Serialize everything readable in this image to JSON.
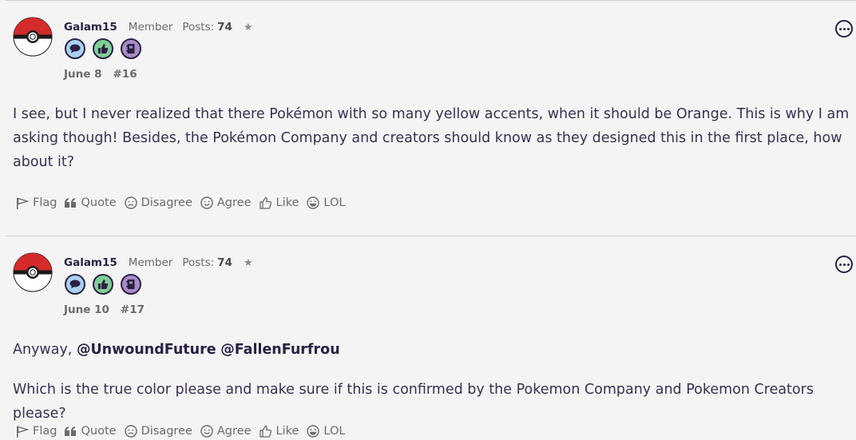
{
  "posts": [
    {
      "username": "Galam15",
      "role": "Member",
      "posts_label": "Posts:",
      "posts_count": "74",
      "date": "June 8",
      "post_number": "#16",
      "body": [
        "I see, but I never realized that there Pokémon with so many yellow accents, when it should be Orange. This is why I am asking though! Besides, the Pokémon Company and creators should know as they designed this in the first place, how about it?"
      ]
    },
    {
      "username": "Galam15",
      "role": "Member",
      "posts_label": "Posts:",
      "posts_count": "74",
      "date": "June 10",
      "post_number": "#17",
      "greeting": "Anyway,",
      "mention_1": "@UnwoundFuture",
      "mention_2": "@FallenFurfrou",
      "question": "Which is the true color please and make sure if this is confirmed by the Pokemon Company and Pokemon Creators please?"
    }
  ],
  "actions": {
    "flag": "Flag",
    "quote": "Quote",
    "disagree": "Disagree",
    "agree": "Agree",
    "like": "Like",
    "lol": "LOL"
  },
  "colors": {
    "page_bg": "#f4f4f4",
    "text": "#3a3150",
    "username": "#2b2143",
    "muted": "#6b6b6b",
    "pokeball_red": "#d32a2a"
  },
  "icons": [
    "pokeball-avatar",
    "comment-badge-icon",
    "thumbs-up-badge-icon",
    "notebook-badge-icon",
    "star-icon",
    "options-menu-icon",
    "flag-icon",
    "quote-icon",
    "disagree-face-icon",
    "agree-face-icon",
    "like-thumb-icon",
    "lol-face-icon"
  ]
}
